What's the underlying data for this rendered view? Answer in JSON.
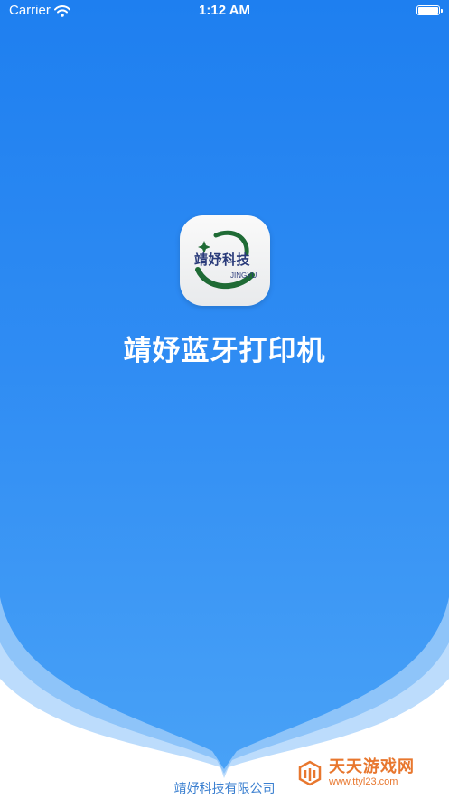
{
  "status_bar": {
    "carrier": "Carrier",
    "time": "1:12 AM"
  },
  "splash": {
    "logo": {
      "text_cn": "靖妤科技",
      "text_en": "JINGYU"
    },
    "title": "靖妤蓝牙打印机",
    "company": "靖妤科技有限公司"
  },
  "watermark": {
    "title": "天天游戏网",
    "url": "www.ttyl23.com"
  },
  "colors": {
    "primary_blue": "#1e7ff0",
    "logo_green": "#1f6b35",
    "logo_navy": "#2a3b7a",
    "watermark_orange": "#e8772e"
  }
}
